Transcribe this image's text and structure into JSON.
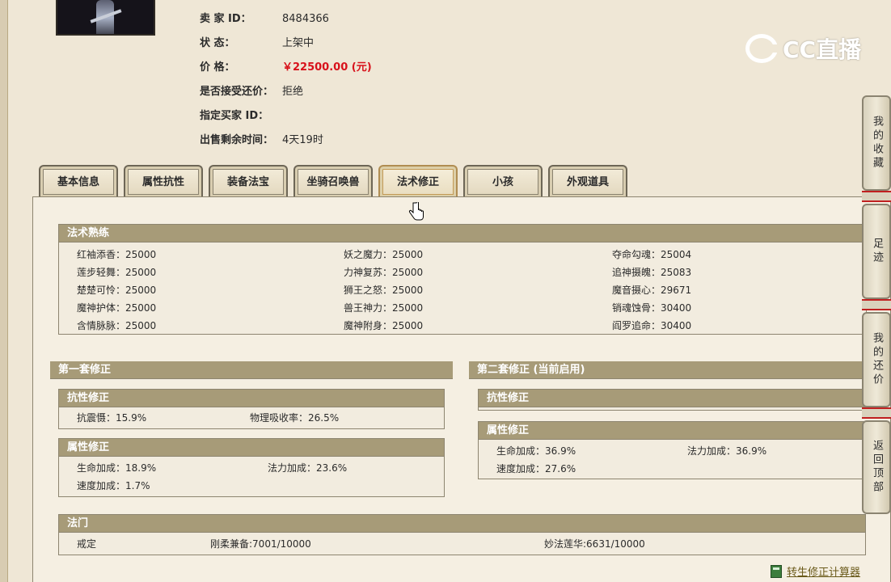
{
  "seller_info": {
    "seller_label": "卖  家   ID：",
    "seller_id": "8484366",
    "status_label": "状       态：",
    "status_value": "上架中",
    "price_label": "价       格：",
    "price_value": "￥22500.00 (元)",
    "counter_label": "是否接受还价：",
    "counter_value": "拒绝",
    "buyer_label": "指定买家 ID：",
    "buyer_value": "",
    "time_label": "出售剩余时间：",
    "time_value": "4天19时"
  },
  "watermark": {
    "text": "CC直播"
  },
  "tabs": [
    {
      "label": "基本信息"
    },
    {
      "label": "属性抗性"
    },
    {
      "label": "装备法宝"
    },
    {
      "label": "坐骑召唤兽"
    },
    {
      "label": "法术修正",
      "active": true
    },
    {
      "label": "小孩"
    },
    {
      "label": "外观道具"
    }
  ],
  "proficiency": {
    "title": "法术熟练",
    "col1": [
      "红袖添香：25000",
      "莲步轻舞：25000",
      "楚楚可怜：25000",
      "魔神护体：25000",
      "含情脉脉：25000"
    ],
    "col2": [
      "妖之魔力：25000",
      "力神复苏：25000",
      "狮王之怒：25000",
      "兽王神力：25000",
      "魔神附身：25000"
    ],
    "col3": [
      "夺命勾魂：25004",
      "追神摄魄：25083",
      "魔音摄心：29671",
      "销魂蚀骨：30400",
      "阎罗追命：30400"
    ]
  },
  "set1": {
    "title": "第一套修正",
    "resist_title": "抗性修正",
    "resist": [
      "抗震慑：15.9%",
      "物理吸收率：26.5%"
    ],
    "attr_title": "属性修正",
    "attr": [
      "生命加成：18.9%",
      "法力加成：23.6%",
      "速度加成：1.7%"
    ]
  },
  "set2": {
    "title": "第二套修正 (当前启用)",
    "resist_title": "抗性修正",
    "attr_title": "属性修正",
    "attr": [
      "生命加成：36.9%",
      "法力加成：36.9%",
      "速度加成：27.6%"
    ]
  },
  "famen": {
    "title": "法门",
    "items": [
      "戒定",
      "刚柔兼备:7001/10000",
      "妙法莲华:6631/10000"
    ]
  },
  "sidebar": {
    "favorites": "我的收藏",
    "footprint": "足迹",
    "counteroffer": "我的还价",
    "top": "返回顶部"
  },
  "calculator_link": "转生修正计算器",
  "colors": {
    "price": "#d8121b",
    "header_bg": "#a79b78",
    "panel_bg": "#f5efe2"
  }
}
